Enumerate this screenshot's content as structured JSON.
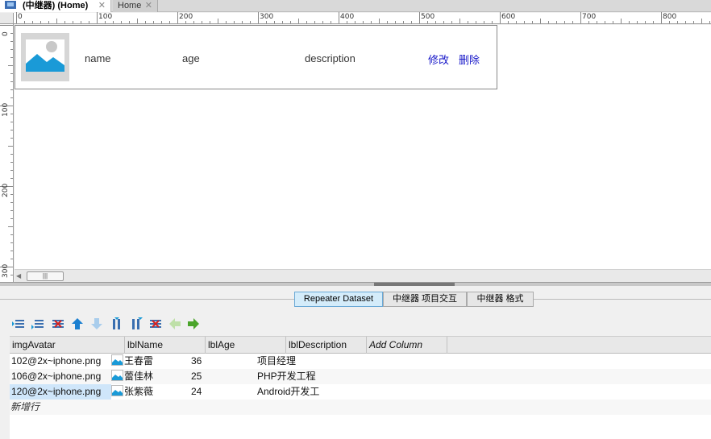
{
  "tabs": [
    {
      "label": "(中继器) (Home)",
      "active": true
    },
    {
      "label": "Home",
      "active": false
    }
  ],
  "ruler": {
    "x_labels": [
      "0",
      "100",
      "200",
      "300",
      "400",
      "500",
      "600",
      "700",
      "800"
    ],
    "y_labels": [
      "0",
      "100",
      "200",
      "300"
    ]
  },
  "repeater": {
    "name": "name",
    "age": "age",
    "description": "description",
    "edit": "修改",
    "delete": "删除"
  },
  "panel": {
    "tabs": [
      "Repeater Dataset",
      "中继器 项目交互",
      "中继器 格式"
    ],
    "toolbar_icons": [
      "insert-row-icon",
      "append-row-icon",
      "delete-row-icon",
      "move-up-icon",
      "move-down-icon",
      "insert-column-icon",
      "append-column-icon",
      "delete-column-icon",
      "move-left-icon",
      "move-right-icon"
    ]
  },
  "grid": {
    "columns": [
      "imgAvatar",
      "lblName",
      "lblAge",
      "lblDescription",
      "Add Column"
    ],
    "rows": [
      {
        "img": "102@2x~iphone.png",
        "name": "王春雷",
        "age": "36",
        "desc": "项目经理"
      },
      {
        "img": "106@2x~iphone.png",
        "name": "蕾佳林",
        "age": "25",
        "desc": "PHP开发工程"
      },
      {
        "img": "120@2x~iphone.png",
        "name": "张紫薇",
        "age": "24",
        "desc": "Android开发工"
      }
    ],
    "new_row": "新增行"
  },
  "colors": {
    "link": "#1515c8",
    "selected": "#cfe6fa",
    "active_tab": "#d4ecfa"
  }
}
